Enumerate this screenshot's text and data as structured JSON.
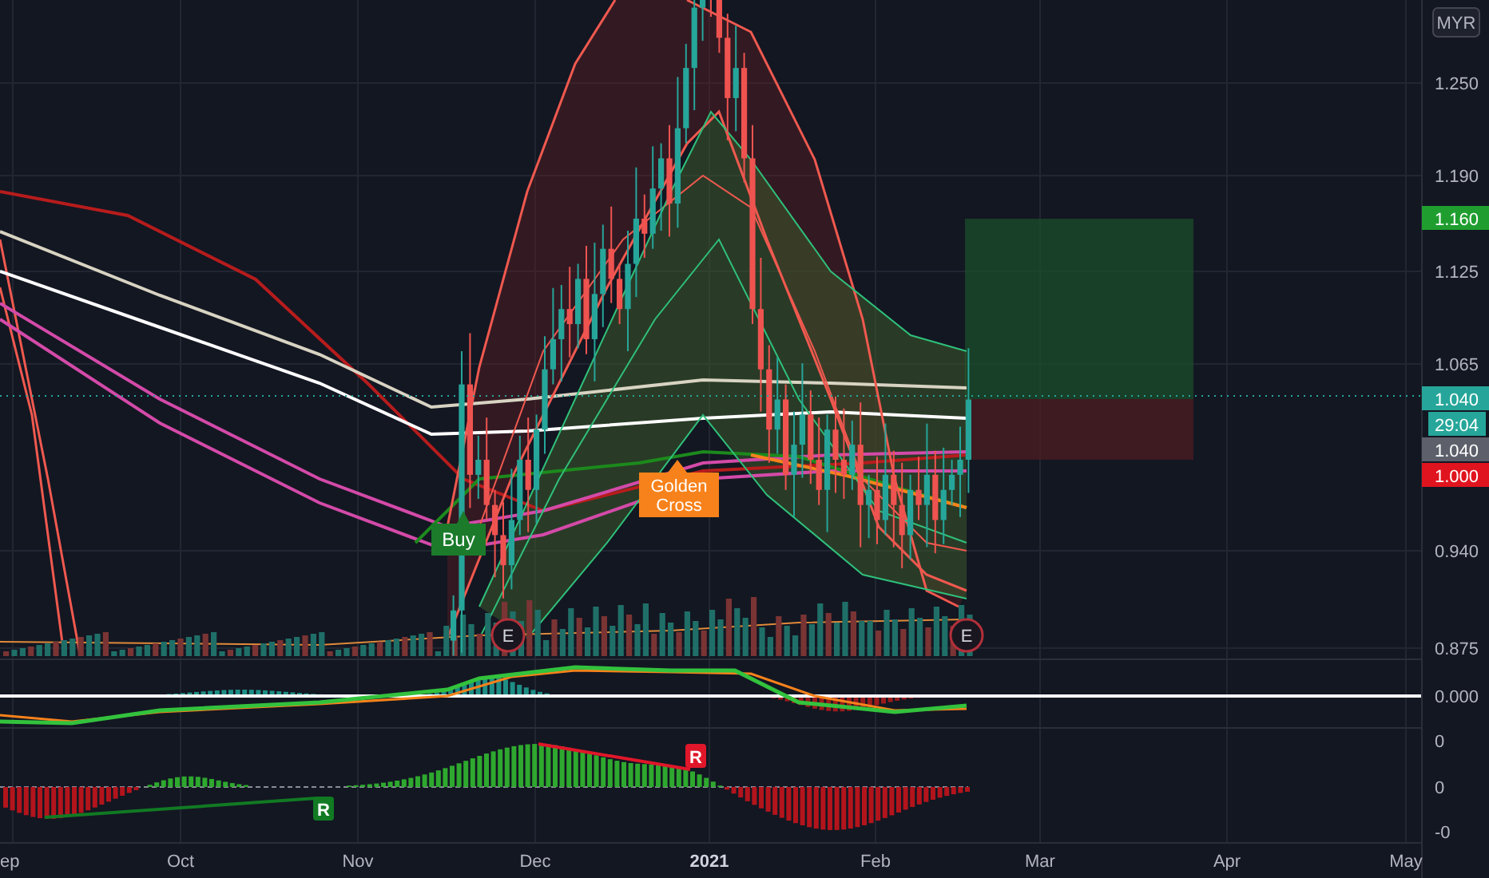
{
  "price_axis": {
    "currency": "MYR",
    "ticks": [
      "1.250",
      "1.190",
      "1.125",
      "1.065",
      "0.940",
      "0.875"
    ]
  },
  "price_labels": [
    {
      "text": "1.160",
      "color": "#1f9e2f"
    },
    {
      "text": "1.040",
      "color": "#26a69a"
    },
    {
      "text": "29:04",
      "color": "#26a69a"
    },
    {
      "text": "1.040",
      "color": "#5d606b"
    },
    {
      "text": "1.000",
      "color": "#e0141e"
    }
  ],
  "markers": [
    {
      "kind": "signal",
      "text": "Buy",
      "color": "#1b7b2b"
    },
    {
      "kind": "signal",
      "text": "Golden Cross",
      "color": "#f7821b"
    },
    {
      "kind": "earnings",
      "text": "E"
    },
    {
      "kind": "earnings",
      "text": "E"
    }
  ],
  "macd_pane": {
    "ticks": [
      "0.000"
    ]
  },
  "oscillator_pane": {
    "ticks": [
      "0",
      "0",
      "-0"
    ],
    "labels": [
      {
        "text": "R",
        "color": "#e0172a"
      },
      {
        "text": "R",
        "color": "#117a23"
      }
    ]
  },
  "time_axis": [
    {
      "label": "ep",
      "bold": false
    },
    {
      "label": "Oct",
      "bold": false
    },
    {
      "label": "Nov",
      "bold": false
    },
    {
      "label": "Dec",
      "bold": false
    },
    {
      "label": "2021",
      "bold": true
    },
    {
      "label": "Feb",
      "bold": false
    },
    {
      "label": "Mar",
      "bold": false
    },
    {
      "label": "Apr",
      "bold": false
    },
    {
      "label": "May",
      "bold": false
    }
  ]
}
